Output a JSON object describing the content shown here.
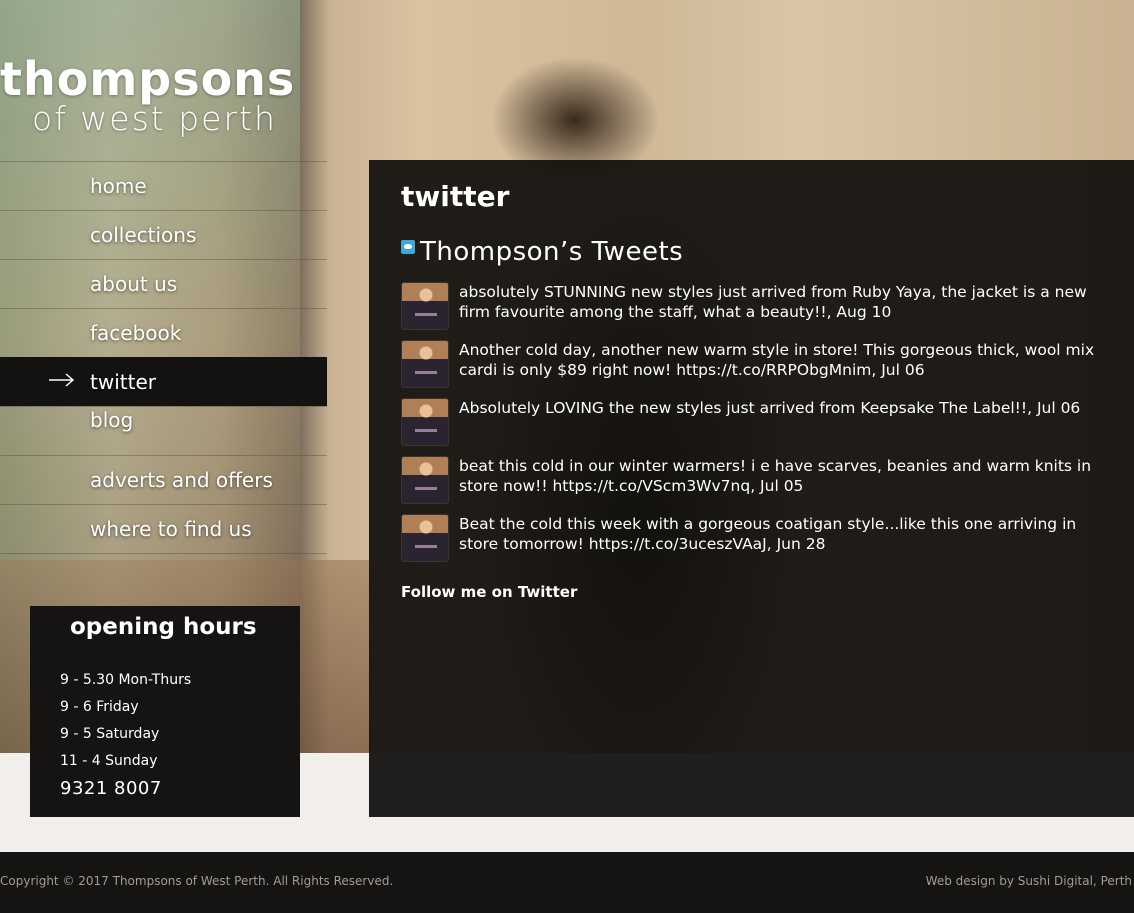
{
  "brand": {
    "line1": "thompsons",
    "line2": "of west perth"
  },
  "nav": {
    "items": [
      {
        "label": "home",
        "active": false
      },
      {
        "label": "collections",
        "active": false
      },
      {
        "label": "about us",
        "active": false
      },
      {
        "label": "facebook",
        "active": false
      },
      {
        "label": "twitter",
        "active": true
      },
      {
        "label": "blog",
        "active": false
      },
      {
        "label": "adverts and offers",
        "active": false
      },
      {
        "label": "where to find us",
        "active": false
      }
    ]
  },
  "hours": {
    "title": "opening hours",
    "rows": [
      "9 - 5.30 Mon-Thurs",
      "9 - 6 Friday",
      "9 - 5 Saturday",
      "11 - 4 Sunday"
    ],
    "phone": "9321 8007"
  },
  "main": {
    "heading": "twitter",
    "feed_title": "Thompson’s Tweets",
    "tweets": [
      {
        "text": "absolutely STUNNING new styles just arrived from Ruby Yaya, the jacket is a new firm favourite among the staff, what a beauty!!, Aug 10"
      },
      {
        "text": "Another cold day, another new warm style in store! This gorgeous thick, wool mix cardi is only $89 right now! https://t.co/RRPObgMnim, Jul 06"
      },
      {
        "text": "Absolutely LOVING the new styles just arrived from Keepsake The Label!!, Jul 06"
      },
      {
        "text": "beat this cold in our winter warmers! i e have scarves, beanies and warm knits in store now!! https://t.co/VScm3Wv7nq, Jul 05"
      },
      {
        "text": "Beat the cold this week with a gorgeous coatigan style...like this one arriving in store tomorrow! https://t.co/3uceszVAaJ, Jun 28"
      }
    ],
    "follow_label": "Follow me on Twitter"
  },
  "footer": {
    "copyright": "Copyright © 2017 Thompsons of West Perth. All Rights Reserved.",
    "credit": "Web design by Sushi Digital, Perth"
  },
  "colors": {
    "panel_bg": "#110f0d",
    "footer_bg": "#161412",
    "page_bg": "#f1eeec",
    "footer_text": "#a39b91",
    "twitter_blue": "#3fa9d8"
  }
}
